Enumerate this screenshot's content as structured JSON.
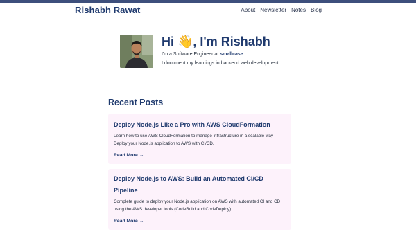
{
  "site": {
    "title": "Rishabh Rawat"
  },
  "nav": {
    "items": [
      {
        "label": "About"
      },
      {
        "label": "Newsletter"
      },
      {
        "label": "Notes"
      },
      {
        "label": "Blog"
      }
    ]
  },
  "hero": {
    "greeting": "Hi 👋, I'm Rishabh",
    "intro_prefix": "I'm a Software Engineer at ",
    "company": "smallcase",
    "intro_suffix": ".",
    "tagline": "I document my learnings in backend web development"
  },
  "recent_posts": {
    "title": "Recent Posts",
    "read_more_label": "Read More →",
    "posts": [
      {
        "title": "Deploy Node.js Like a Pro with AWS CloudFormation",
        "description": "Learn how to use AWS CloudFormation to manage infrastructure in a scalable way – Deploy your Node.js application to AWS with CI/CD."
      },
      {
        "title": "Deploy Node.js to AWS: Build an Automated CI/CD Pipeline",
        "description": "Complete guide to deploy your Node.js application on AWS with automated CI and CD using the AWS developer tools (CodeBuild and CodeDeploy)."
      }
    ]
  },
  "colors": {
    "brand": "#1f3a6e",
    "topbar": "#3d4f7c",
    "card_background": "#fdf2fb"
  }
}
